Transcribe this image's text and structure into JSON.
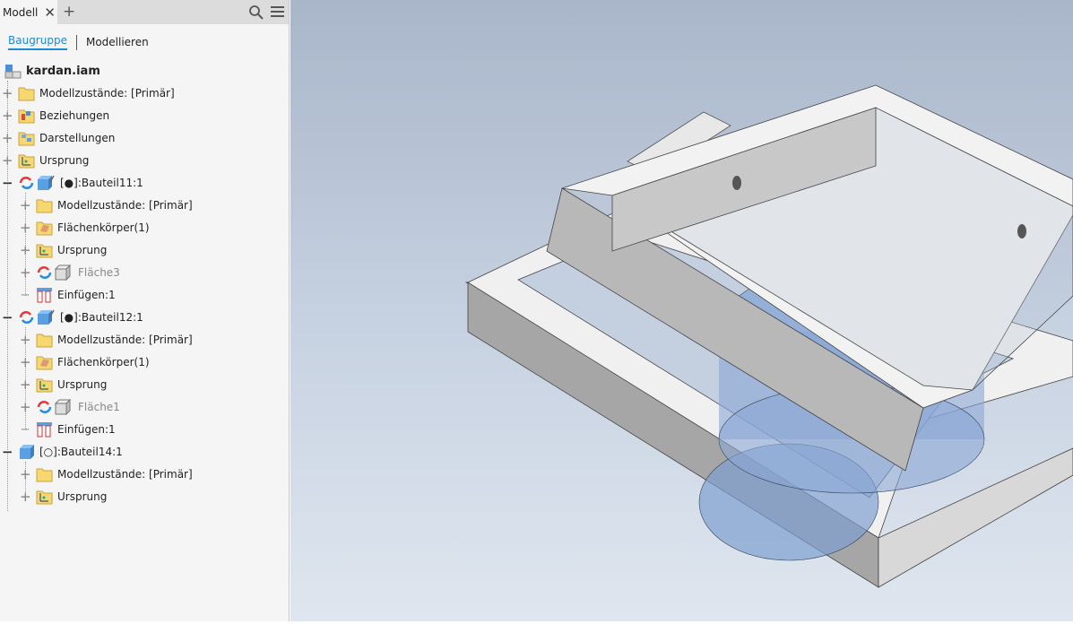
{
  "panel": {
    "tab_label": "Modell",
    "subtabs": [
      "Baugruppe",
      "Modellieren"
    ]
  },
  "tree": [
    {
      "label": "kardan.iam",
      "level": 0,
      "icon": "assembly-icon",
      "bold": true
    },
    {
      "label": "Modellzustände: [Primär]",
      "level": 1,
      "icon": "folder-icon"
    },
    {
      "label": "Beziehungen",
      "level": 1,
      "icon": "relationships-folder-icon"
    },
    {
      "label": "Darstellungen",
      "level": 1,
      "icon": "representations-folder-icon"
    },
    {
      "label": "Ursprung",
      "level": 1,
      "icon": "origin-folder-icon"
    },
    {
      "label": "[●]:Bauteil11:1",
      "level": 1,
      "icon": "part-icon",
      "expanded": true
    },
    {
      "label": "Modellzustände: [Primär]",
      "level": 2,
      "icon": "folder-icon"
    },
    {
      "label": "Flächenkörper(1)",
      "level": 2,
      "icon": "surface-body-folder-icon"
    },
    {
      "label": "Ursprung",
      "level": 2,
      "icon": "origin-folder-icon"
    },
    {
      "label": "Fläche3",
      "level": 2,
      "icon": "surface-icon",
      "dim": true
    },
    {
      "label": "Einfügen:1",
      "level": 2,
      "icon": "insert-constraint-icon",
      "leaf": true
    },
    {
      "label": "[●]:Bauteil12:1",
      "level": 1,
      "icon": "part-icon",
      "expanded": true
    },
    {
      "label": "Modellzustände: [Primär]",
      "level": 2,
      "icon": "folder-icon"
    },
    {
      "label": "Flächenkörper(1)",
      "level": 2,
      "icon": "surface-body-folder-icon"
    },
    {
      "label": "Ursprung",
      "level": 2,
      "icon": "origin-folder-icon"
    },
    {
      "label": "Fläche1",
      "level": 2,
      "icon": "surface-icon",
      "dim": true
    },
    {
      "label": "Einfügen:1",
      "level": 2,
      "icon": "insert-constraint-icon",
      "leaf": true
    },
    {
      "label": "[○]:Bauteil14:1",
      "level": 1,
      "icon": "part-plain-icon",
      "expanded": true
    },
    {
      "label": "Modellzustände: [Primär]",
      "level": 2,
      "icon": "folder-icon"
    },
    {
      "label": "Ursprung",
      "level": 2,
      "icon": "origin-folder-icon"
    }
  ]
}
